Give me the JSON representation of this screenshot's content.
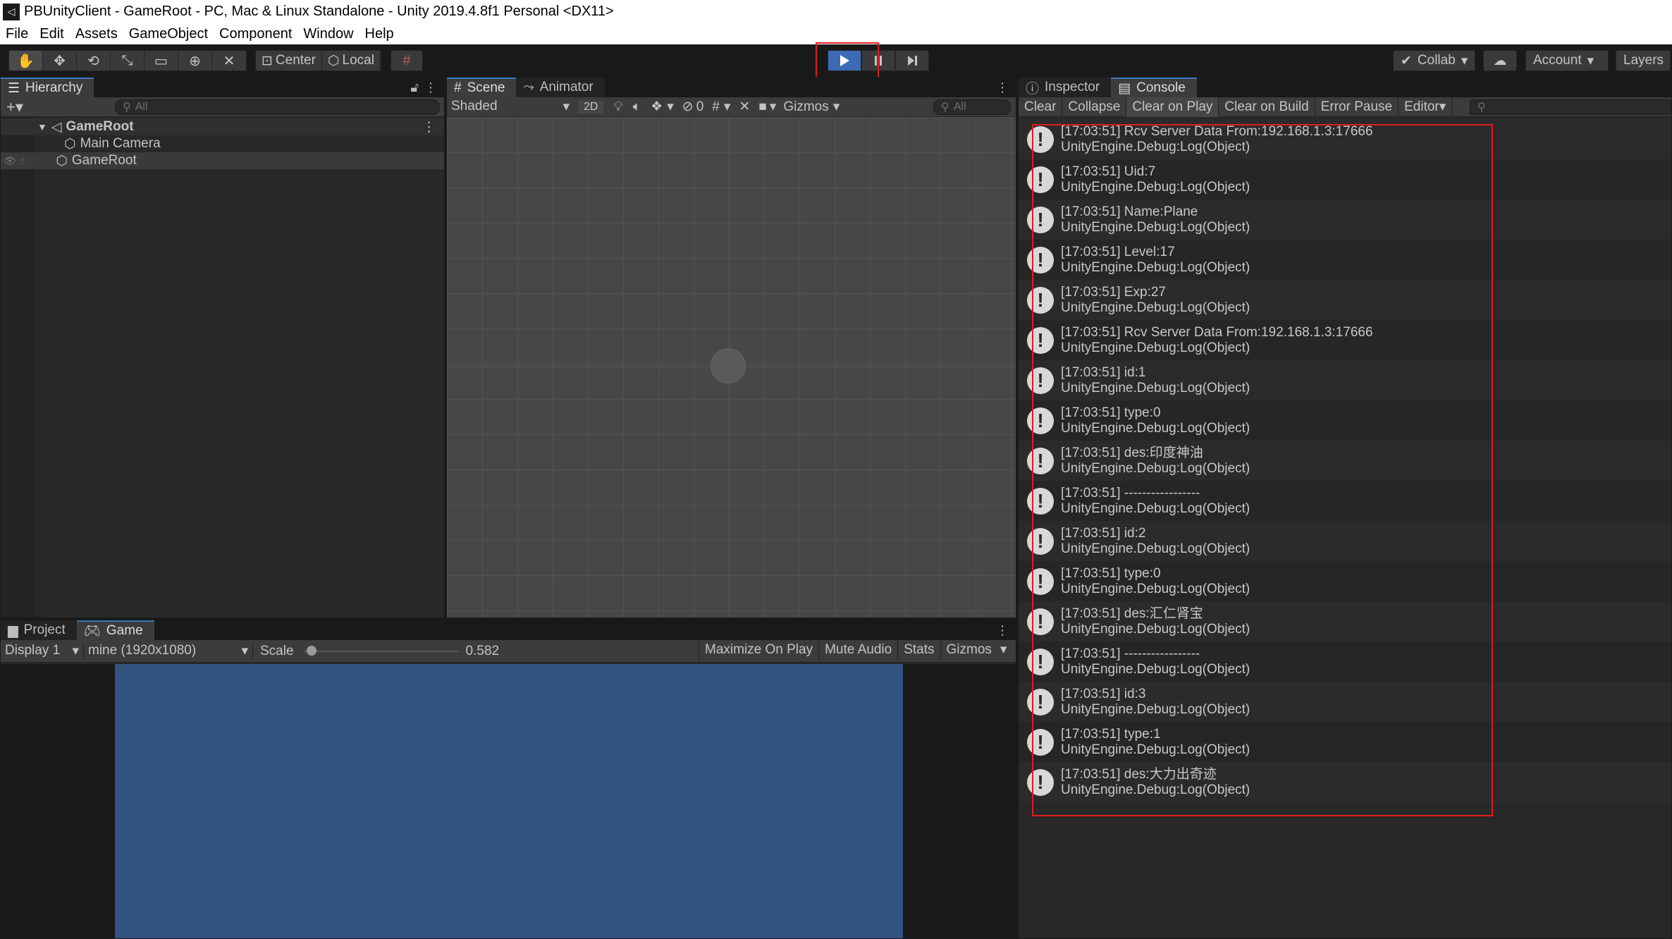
{
  "window": {
    "title": "PBUnityClient - GameRoot - PC, Mac & Linux Standalone - Unity 2019.4.8f1 Personal <DX11>"
  },
  "menu": [
    "File",
    "Edit",
    "Assets",
    "GameObject",
    "Component",
    "Window",
    "Help"
  ],
  "toolbar": {
    "pivot_center": "Center",
    "pivot_local": "Local",
    "collab": "Collab",
    "account": "Account",
    "layers": "Layers"
  },
  "hierarchy": {
    "tab": "Hierarchy",
    "search_placeholder": "All",
    "scene": "GameRoot",
    "items": [
      "Main Camera",
      "GameRoot"
    ]
  },
  "scene": {
    "tabs": [
      "Scene",
      "Animator"
    ],
    "shading": "Shaded",
    "mode_2d": "2D",
    "hidden_count": "0",
    "gizmos": "Gizmos",
    "search_placeholder": "All"
  },
  "game": {
    "tabs": [
      "Project",
      "Game"
    ],
    "display": "Display 1",
    "resolution": "mine (1920x1080)",
    "scale_label": "Scale",
    "scale_value": "0.582",
    "scale_fraction": 0.02,
    "maximize": "Maximize On Play",
    "mute": "Mute Audio",
    "stats": "Stats",
    "gizmos": "Gizmos"
  },
  "console": {
    "tabs": [
      "Inspector",
      "Console"
    ],
    "buttons": [
      "Clear",
      "Collapse",
      "Clear on Play",
      "Clear on Build",
      "Error Pause",
      "Editor"
    ],
    "entries": [
      {
        "line1": "[17:03:51] Rcv  Server Data From:192.168.1.3:17666",
        "line2": "UnityEngine.Debug:Log(Object)"
      },
      {
        "line1": "[17:03:51] Uid:7",
        "line2": "UnityEngine.Debug:Log(Object)"
      },
      {
        "line1": "[17:03:51] Name:Plane",
        "line2": "UnityEngine.Debug:Log(Object)"
      },
      {
        "line1": "[17:03:51] Level:17",
        "line2": "UnityEngine.Debug:Log(Object)"
      },
      {
        "line1": "[17:03:51] Exp:27",
        "line2": "UnityEngine.Debug:Log(Object)"
      },
      {
        "line1": "[17:03:51] Rcv  Server Data From:192.168.1.3:17666",
        "line2": "UnityEngine.Debug:Log(Object)"
      },
      {
        "line1": "[17:03:51] id:1",
        "line2": "UnityEngine.Debug:Log(Object)"
      },
      {
        "line1": "[17:03:51] type:0",
        "line2": "UnityEngine.Debug:Log(Object)"
      },
      {
        "line1": "[17:03:51] des:印度神油",
        "line2": "UnityEngine.Debug:Log(Object)"
      },
      {
        "line1": "[17:03:51] -----------------",
        "line2": "UnityEngine.Debug:Log(Object)"
      },
      {
        "line1": "[17:03:51] id:2",
        "line2": "UnityEngine.Debug:Log(Object)"
      },
      {
        "line1": "[17:03:51] type:0",
        "line2": "UnityEngine.Debug:Log(Object)"
      },
      {
        "line1": "[17:03:51] des:汇仁肾宝",
        "line2": "UnityEngine.Debug:Log(Object)"
      },
      {
        "line1": "[17:03:51] -----------------",
        "line2": "UnityEngine.Debug:Log(Object)"
      },
      {
        "line1": "[17:03:51] id:3",
        "line2": "UnityEngine.Debug:Log(Object)"
      },
      {
        "line1": "[17:03:51] type:1",
        "line2": "UnityEngine.Debug:Log(Object)"
      },
      {
        "line1": "[17:03:51] des:大力出奇迹",
        "line2": "UnityEngine.Debug:Log(Object)"
      }
    ]
  },
  "colors": {
    "accent": "#3a79bb",
    "play_active": "#3c6ab5",
    "highlight": "#e01d1d",
    "game_bg": "#315380"
  }
}
